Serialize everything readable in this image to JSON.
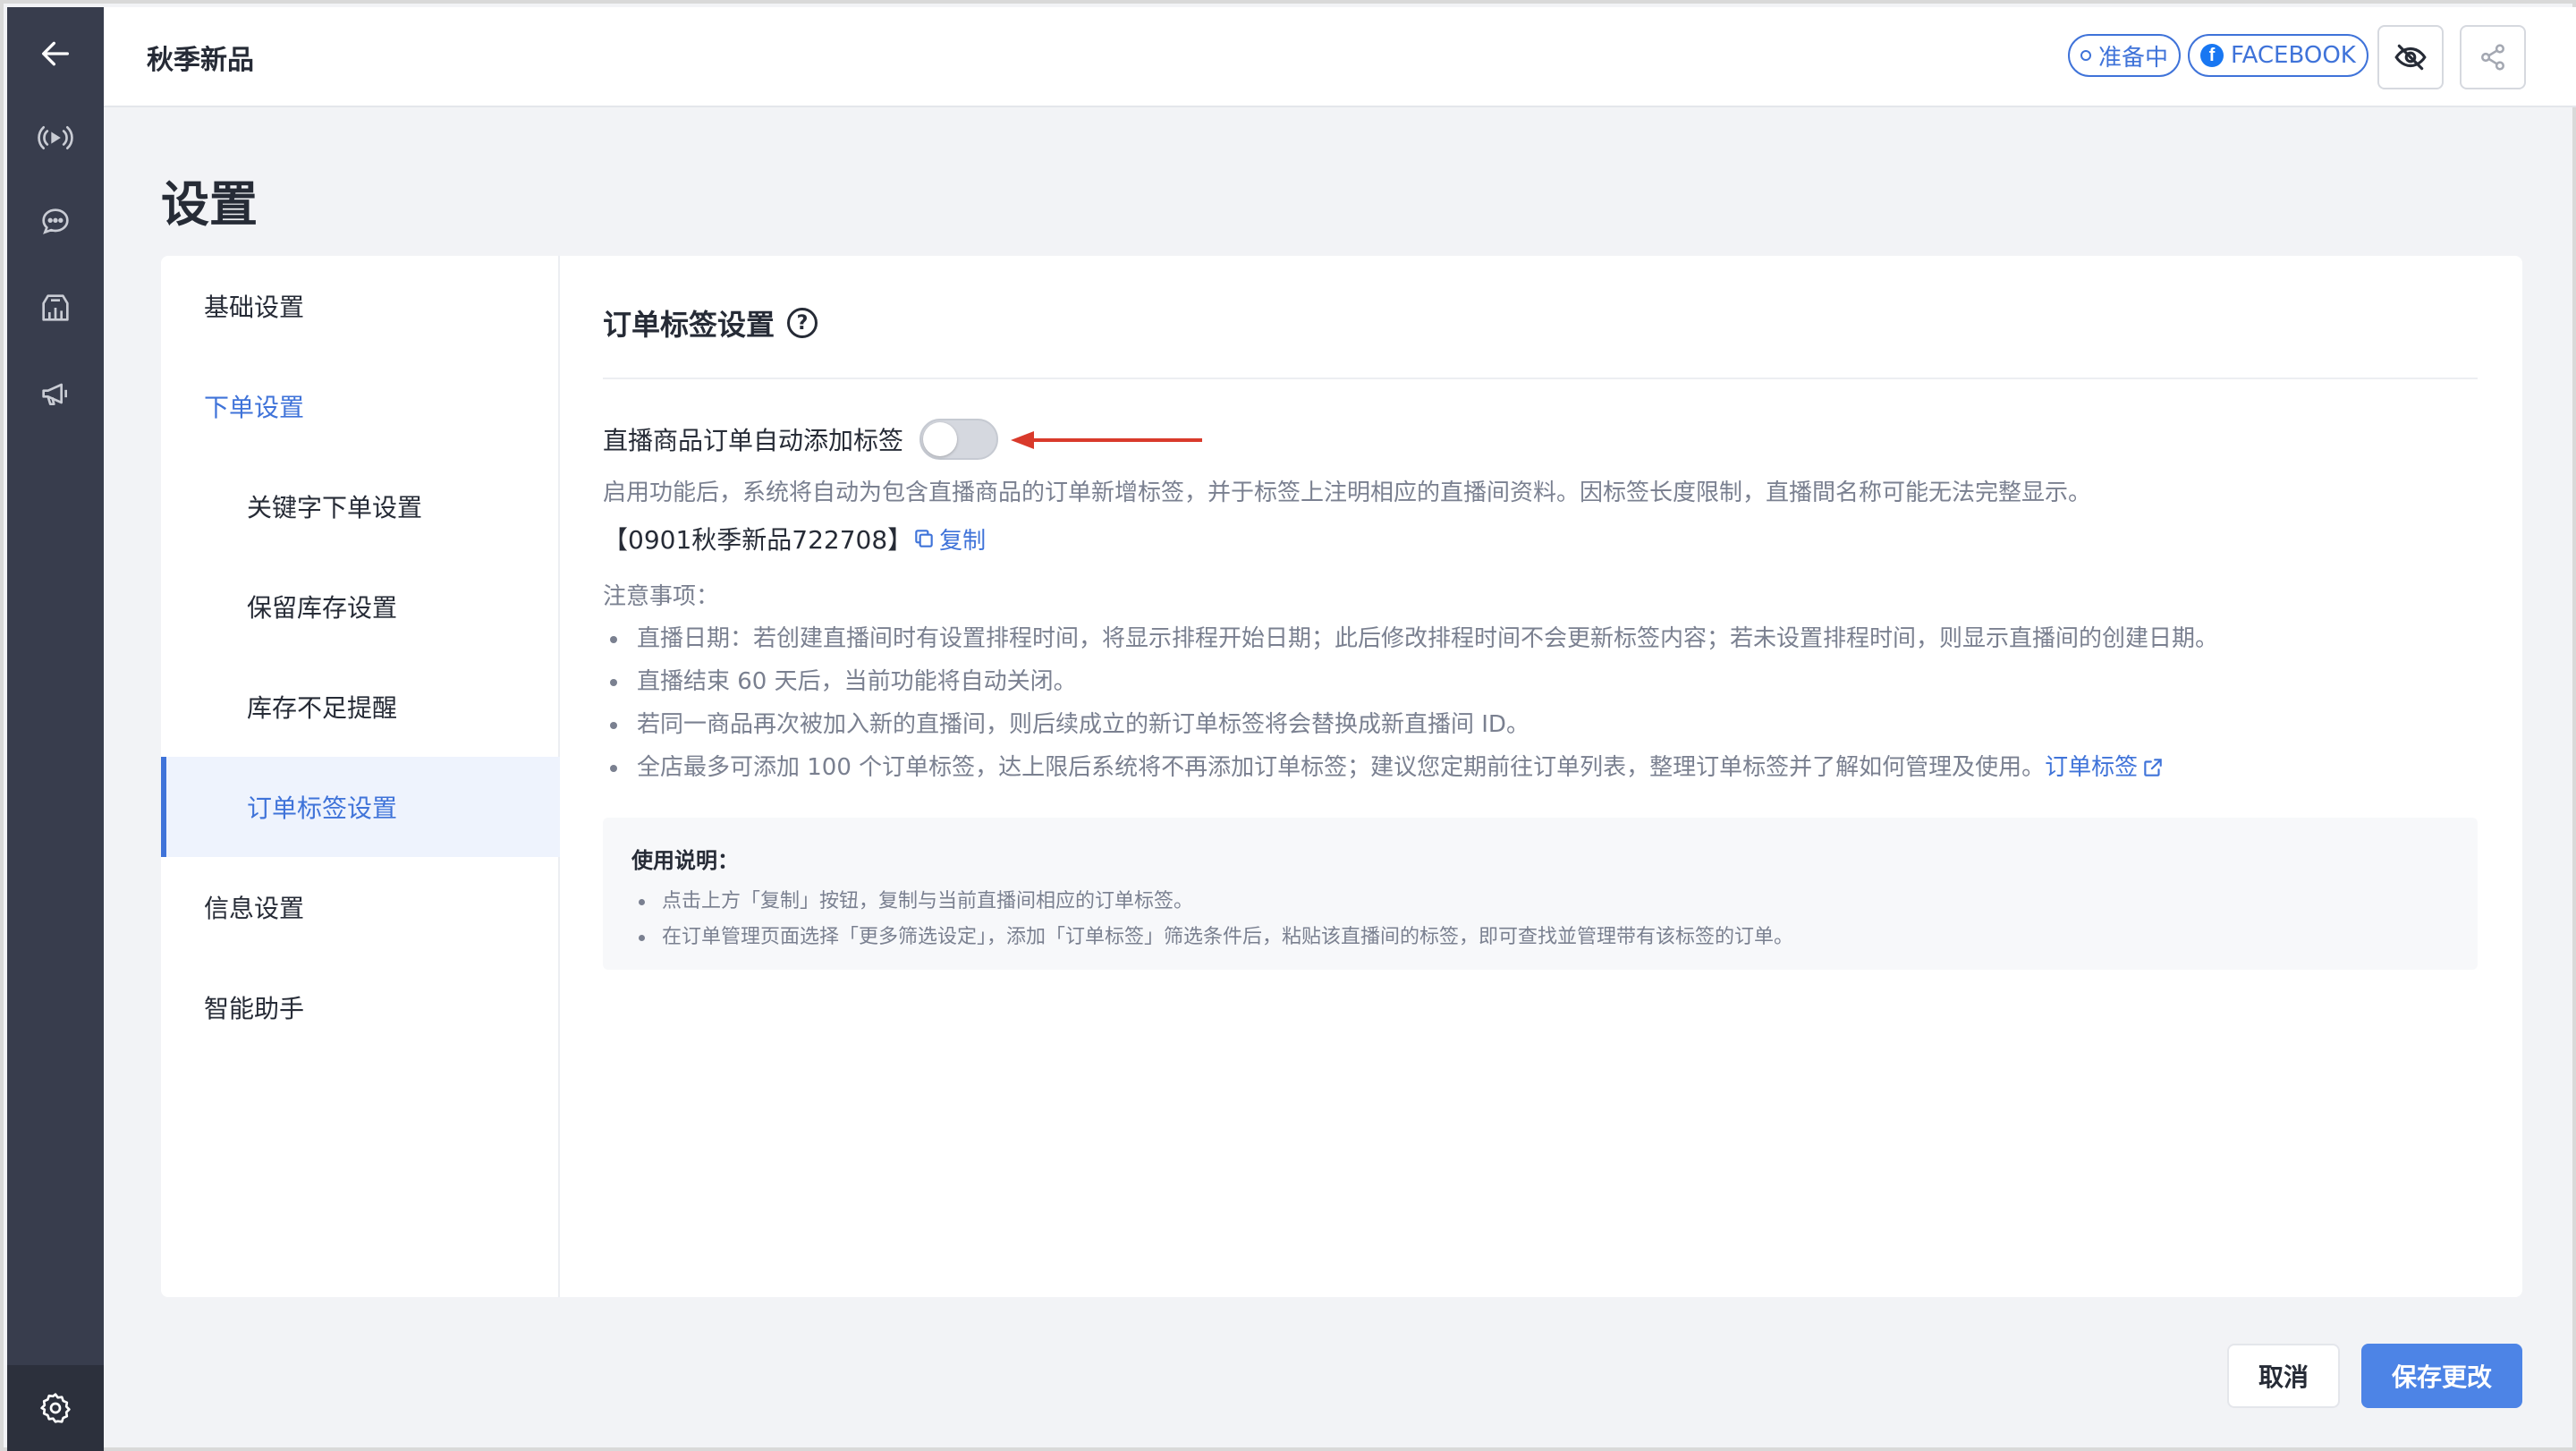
{
  "topbar": {
    "title": "秋季新品",
    "status_label": "准备中",
    "platform_label": "FACEBOOK",
    "platform_icon_letter": "f"
  },
  "rail": {
    "icons": [
      "back-arrow-icon",
      "live-broadcast-icon",
      "chat-bubble-icon",
      "shop-analytics-icon",
      "megaphone-icon",
      "gear-icon"
    ]
  },
  "page": {
    "title": "设置"
  },
  "sidenav": {
    "items": [
      {
        "label": "基础设置"
      },
      {
        "label": "下单设置"
      },
      {
        "label": "关键字下单设置"
      },
      {
        "label": "保留库存设置"
      },
      {
        "label": "库存不足提醒"
      },
      {
        "label": "订单标签设置"
      },
      {
        "label": "信息设置"
      },
      {
        "label": "智能助手"
      }
    ]
  },
  "content": {
    "section_title": "订单标签设置",
    "help_glyph": "?",
    "toggle_label": "直播商品订单自动添加标签",
    "toggle_on": false,
    "description": "启用功能后，系统将自动为包含直播商品的订单新增标签，并于标签上注明相应的直播间资料。因标签长度限制，直播間名称可能无法完整显示。",
    "tag_text": "【0901秋季新品722708】",
    "copy_label": "复制",
    "notes_title": "注意事项：",
    "notes": [
      "直播日期：若创建直播间时有设置排程时间，将显示排程开始日期；此后修改排程时间不会更新标签内容；若未设置排程时间，则显示直播间的创建日期。",
      "直播结束 60 天后，当前功能将自动关闭。",
      "若同一商品再次被加入新的直播间，则后续成立的新订单标签将会替换成新直播间 ID。",
      "全店最多可添加 100 个订单标签，达上限后系统将不再添加订单标签；建议您定期前往订单列表，整理订单标签并了解如何管理及使用。"
    ],
    "notes_link": "订单标签",
    "usage_title": "使用说明：",
    "usage": [
      "点击上方「复制」按钮，复制与当前直播间相应的订单标签。",
      "在订单管理页面选择「更多筛选设定」，添加「订单标签」筛选条件后，粘贴该直播间的标签，即可查找並管理带有该标签的订单。"
    ]
  },
  "footer": {
    "cancel_label": "取消",
    "save_label": "保存更改"
  },
  "colors": {
    "accent": "#3f73d9",
    "save_button": "#4d84e6",
    "rail": "#383d4d",
    "annotation_arrow": "#d93a2b"
  }
}
